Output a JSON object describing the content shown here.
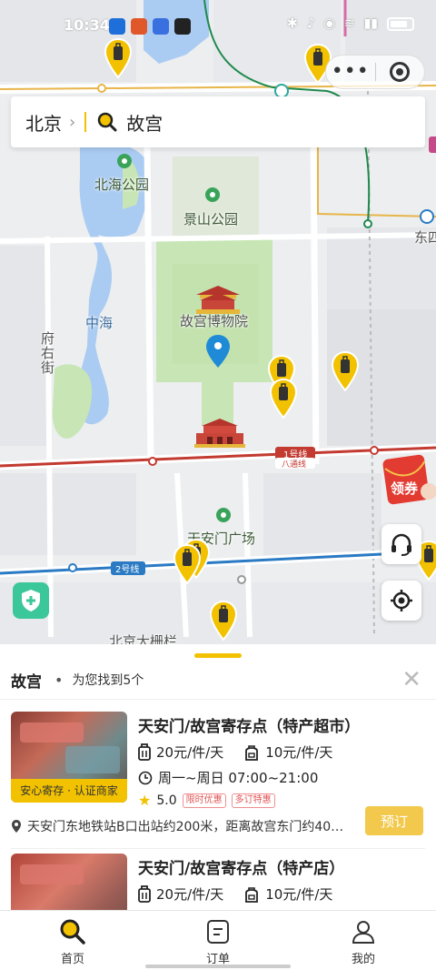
{
  "status_bar": {
    "time": "10:34"
  },
  "search": {
    "city": "北京",
    "query": "故宫"
  },
  "map": {
    "labels": {
      "beihai_park": "北海公园",
      "jingshan_park": "景山公园",
      "zhonghai": "中海",
      "palace_museum": "故宫博物院",
      "fuyou_street": "府右街",
      "tiananmen_square": "天安门广场",
      "dongsi": "东四",
      "dazhalan": "北京大栅栏",
      "line1": "1号线",
      "line1_sub": "八通线",
      "line2": "2号线",
      "coupon": "领券"
    },
    "colors": {
      "brand_yellow": "#f2c200",
      "water": "#aacbf2",
      "park": "#c8e6b5",
      "line1": "#c23a30",
      "line2": "#2a7ac4"
    }
  },
  "results": {
    "keyword": "故宫",
    "summary": "为您找到5个",
    "items": [
      {
        "title": "天安门/故宫寄存点（特产超市）",
        "price_large": "20元/件/天",
        "price_small": "10元/件/天",
        "hours": "周一~周日 07:00~21:00",
        "rating": "5.0",
        "badges": [
          "限时优惠",
          "多订特惠"
        ],
        "thumb_tag": "安心寄存 · 认证商家",
        "address": "天安门东地铁站B口出站约200米，距离故宫东门约40…",
        "book_label": "预订"
      },
      {
        "title": "天安门/故宫寄存点（特产店）",
        "price_large": "20元/件/天",
        "price_small": "10元/件/天"
      }
    ]
  },
  "tabs": [
    {
      "label": "首页",
      "icon": "search-icon"
    },
    {
      "label": "订单",
      "icon": "order-icon"
    },
    {
      "label": "我的",
      "icon": "user-icon"
    }
  ]
}
